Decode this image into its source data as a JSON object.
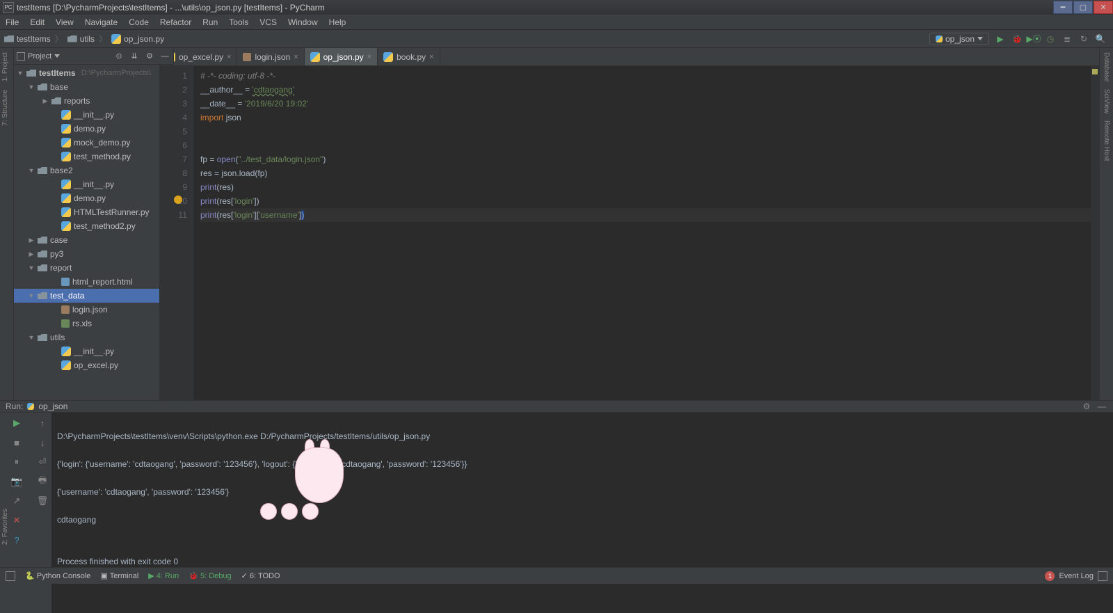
{
  "titlebar": {
    "text": "testItems [D:\\PycharmProjects\\testItems] - ...\\utils\\op_json.py [testItems] - PyCharm"
  },
  "menu": [
    "File",
    "Edit",
    "View",
    "Navigate",
    "Code",
    "Refactor",
    "Run",
    "Tools",
    "VCS",
    "Window",
    "Help"
  ],
  "breadcrumbs": {
    "root": "testItems",
    "folder": "utils",
    "file": "op_json.py"
  },
  "run_config": {
    "label": "op_json"
  },
  "project_toolbar": {
    "label": "Project"
  },
  "left_tabs": [
    "1: Project",
    "7: Structure"
  ],
  "right_tabs": [
    "Database",
    "SciView",
    "Remote Host"
  ],
  "left_bottom_tab": "2: Favorites",
  "tree": {
    "root": {
      "name": "testItems",
      "path": "D:\\PycharmProjects\\"
    },
    "base": {
      "name": "base",
      "reports": "reports",
      "files": [
        "__init__.py",
        "demo.py",
        "mock_demo.py",
        "test_method.py"
      ]
    },
    "base2": {
      "name": "base2",
      "files": [
        "__init__.py",
        "demo.py",
        "HTMLTestRunner.py",
        "test_method2.py"
      ]
    },
    "case": "case",
    "py3": "py3",
    "report": {
      "name": "report",
      "files": [
        "html_report.html"
      ]
    },
    "test_data": {
      "name": "test_data",
      "files": [
        "login.json",
        "rs.xls"
      ]
    },
    "utils": {
      "name": "utils",
      "files": [
        "__init__.py",
        "op_excel.py"
      ]
    }
  },
  "tabs": [
    {
      "label": "op_excel.py",
      "type": "py"
    },
    {
      "label": "login.json",
      "type": "json"
    },
    {
      "label": "op_json.py",
      "type": "py",
      "active": true
    },
    {
      "label": "book.py",
      "type": "py"
    }
  ],
  "code": {
    "lines": {
      "1": {
        "comment": "# -*- coding: utf-8 -*-"
      },
      "2": {
        "dunder": "__author__",
        "eq": " = ",
        "str": "'cdtaogang'"
      },
      "3": {
        "dunder": "__date__",
        "eq": " = ",
        "str": "'2019/6/20 19:02'"
      },
      "4": {
        "key": "import ",
        "id": "json"
      },
      "5": "",
      "6": "",
      "7": {
        "p1": "fp = ",
        "fn": "open",
        "p2": "(",
        "str": "\"../test_data/login.json\"",
        "p3": ")"
      },
      "8": {
        "txt": "res = json.load(fp)"
      },
      "9": {
        "fn": "print",
        "p": "(res)"
      },
      "10": {
        "fn": "print",
        "p1": "(res[",
        "str": "'login'",
        "p2": "])"
      },
      "11": {
        "fn": "print",
        "p1": "(res[",
        "str1": "'login'",
        "p2": "][",
        "str2": "'username'",
        "p3": "]",
        "end": ")"
      }
    }
  },
  "run_panel": {
    "title": "Run:",
    "name": "op_json"
  },
  "console": {
    "l1": "D:\\PycharmProjects\\testItems\\venv\\Scripts\\python.exe D:/PycharmProjects/testItems/utils/op_json.py",
    "l2": "{'login': {'username': 'cdtaogang', 'password': '123456'}, 'logout': {'username': 'cdtaogang', 'password': '123456'}}",
    "l3": "{'username': 'cdtaogang', 'password': '123456'}",
    "l4": "cdtaogang",
    "l5": "",
    "l6": "Process finished with exit code 0"
  },
  "statusbar": {
    "items": [
      "Python Console",
      "Terminal",
      "4: Run",
      "5: Debug",
      "6: TODO"
    ],
    "event_log": "Event Log",
    "err_count": "1"
  }
}
